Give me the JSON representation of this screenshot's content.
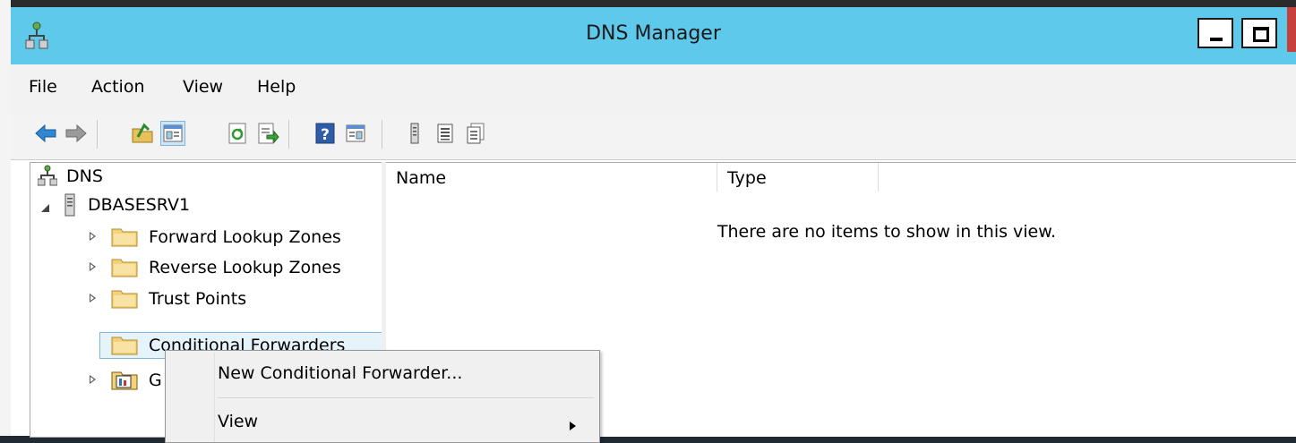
{
  "window": {
    "title": "DNS Manager"
  },
  "menubar": {
    "items": [
      "File",
      "Action",
      "View",
      "Help"
    ]
  },
  "toolbar": {
    "buttons": [
      "back-arrow-icon",
      "forward-arrow-icon",
      "up-one-level-icon",
      "show-hide-console-tree-icon",
      "refresh-icon",
      "export-list-icon",
      "help-icon",
      "show-hide-action-pane-icon",
      "server-icon",
      "list-view-icon",
      "properties-icon"
    ]
  },
  "tree": {
    "root": "DNS",
    "server": "DBASESRV1",
    "children": [
      "Forward Lookup Zones",
      "Reverse Lookup Zones",
      "Trust Points",
      "Conditional Forwarders",
      "G"
    ]
  },
  "list": {
    "columns": [
      "Name",
      "Type"
    ],
    "empty_message": "There are no items to show in this view."
  },
  "context_menu": {
    "items": [
      "New Conditional Forwarder...",
      "View"
    ]
  },
  "colors": {
    "titlebar": "#5fc9ec",
    "selection": "#e5f3fb",
    "folder": "#f2d27a"
  }
}
